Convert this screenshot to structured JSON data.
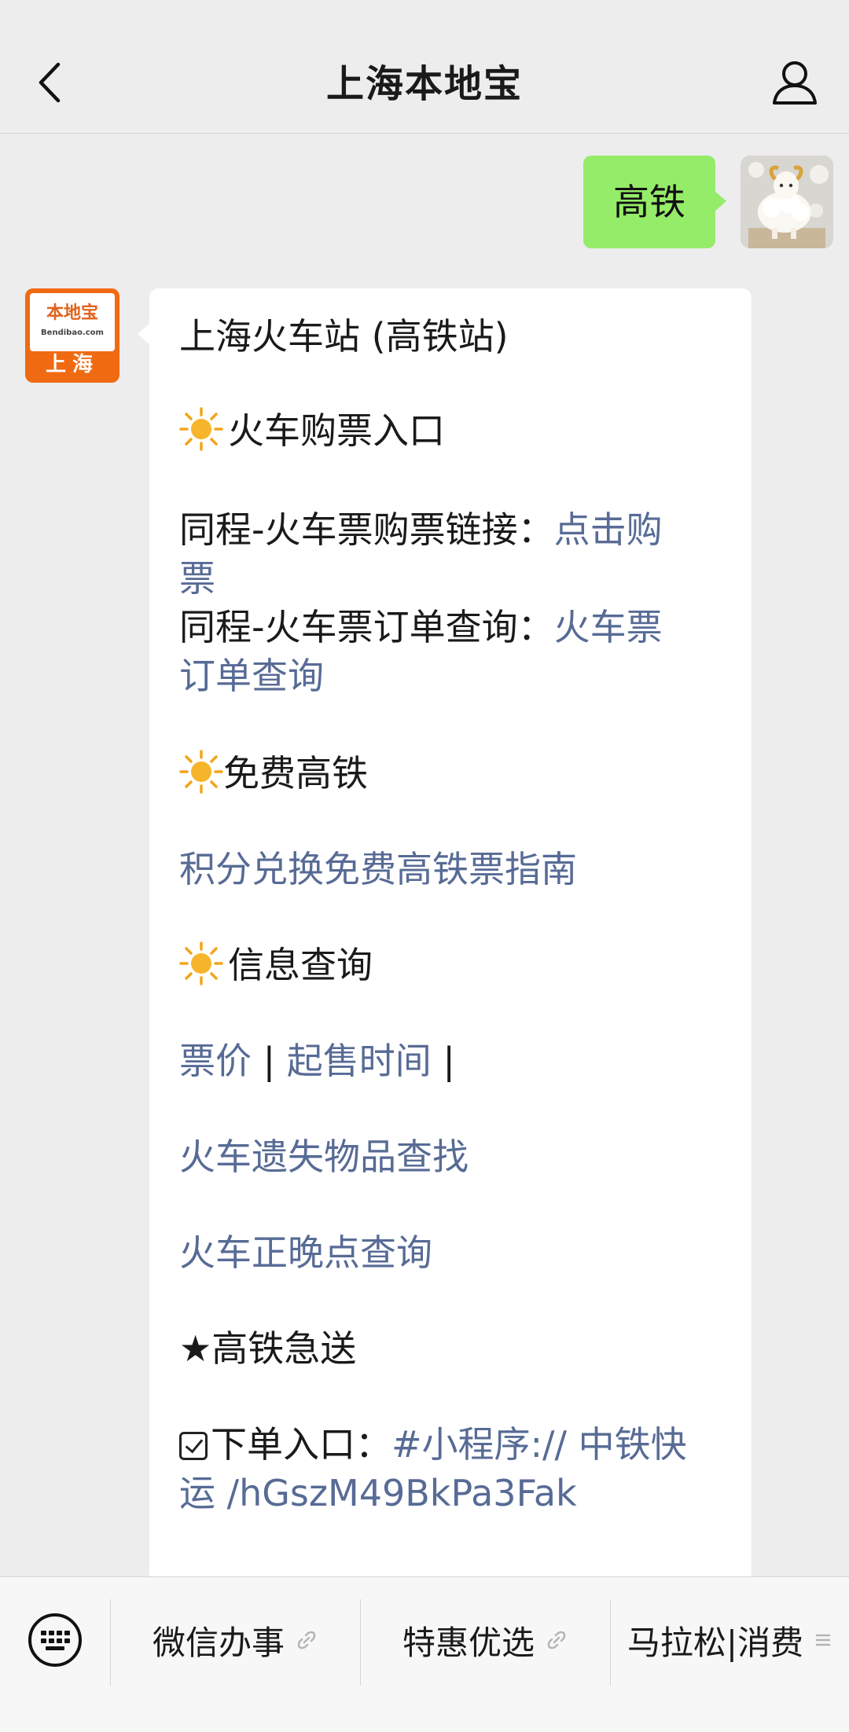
{
  "header": {
    "title": "上海本地宝"
  },
  "outgoing_message": "高铁",
  "bot_avatar": {
    "brand": "本地宝",
    "domain": "Bendibao.com",
    "city": "上海"
  },
  "reply": {
    "line_station": "上海火车站 (高铁站)",
    "section_ticket": "火车购票入口",
    "ticket_buy_label": "同程-火车票购票链接：",
    "ticket_buy_link_1": "点击购",
    "ticket_buy_link_2": "票",
    "ticket_order_label": "同程-火车票订单查询：",
    "ticket_order_link_1": "火车票",
    "ticket_order_link_2": "订单查询",
    "section_free": "免费高铁",
    "free_guide_link": "积分兑换免费高铁票指南",
    "section_info": "信息查询",
    "price_link": "票价",
    "pipe_1": " | ",
    "sale_time_link": "起售时间",
    "pipe_2": " |",
    "lost_items_link": "火车遗失物品查找",
    "delay_link": "火车正晚点查询",
    "section_express": "★高铁急送",
    "order_entry_label": "下单入口：",
    "order_entry_link_1": "#小程序:// 中铁快",
    "order_entry_link_2": "运 /hGszM49BkPa3Fak"
  },
  "bottom_menu": {
    "items": [
      "微信办事",
      "特惠优选",
      "马拉松|消费"
    ]
  },
  "colors": {
    "outgoing_bubble": "#95ec69",
    "link": "#576b95",
    "background": "#ededed",
    "brand_orange": "#f06a12"
  }
}
